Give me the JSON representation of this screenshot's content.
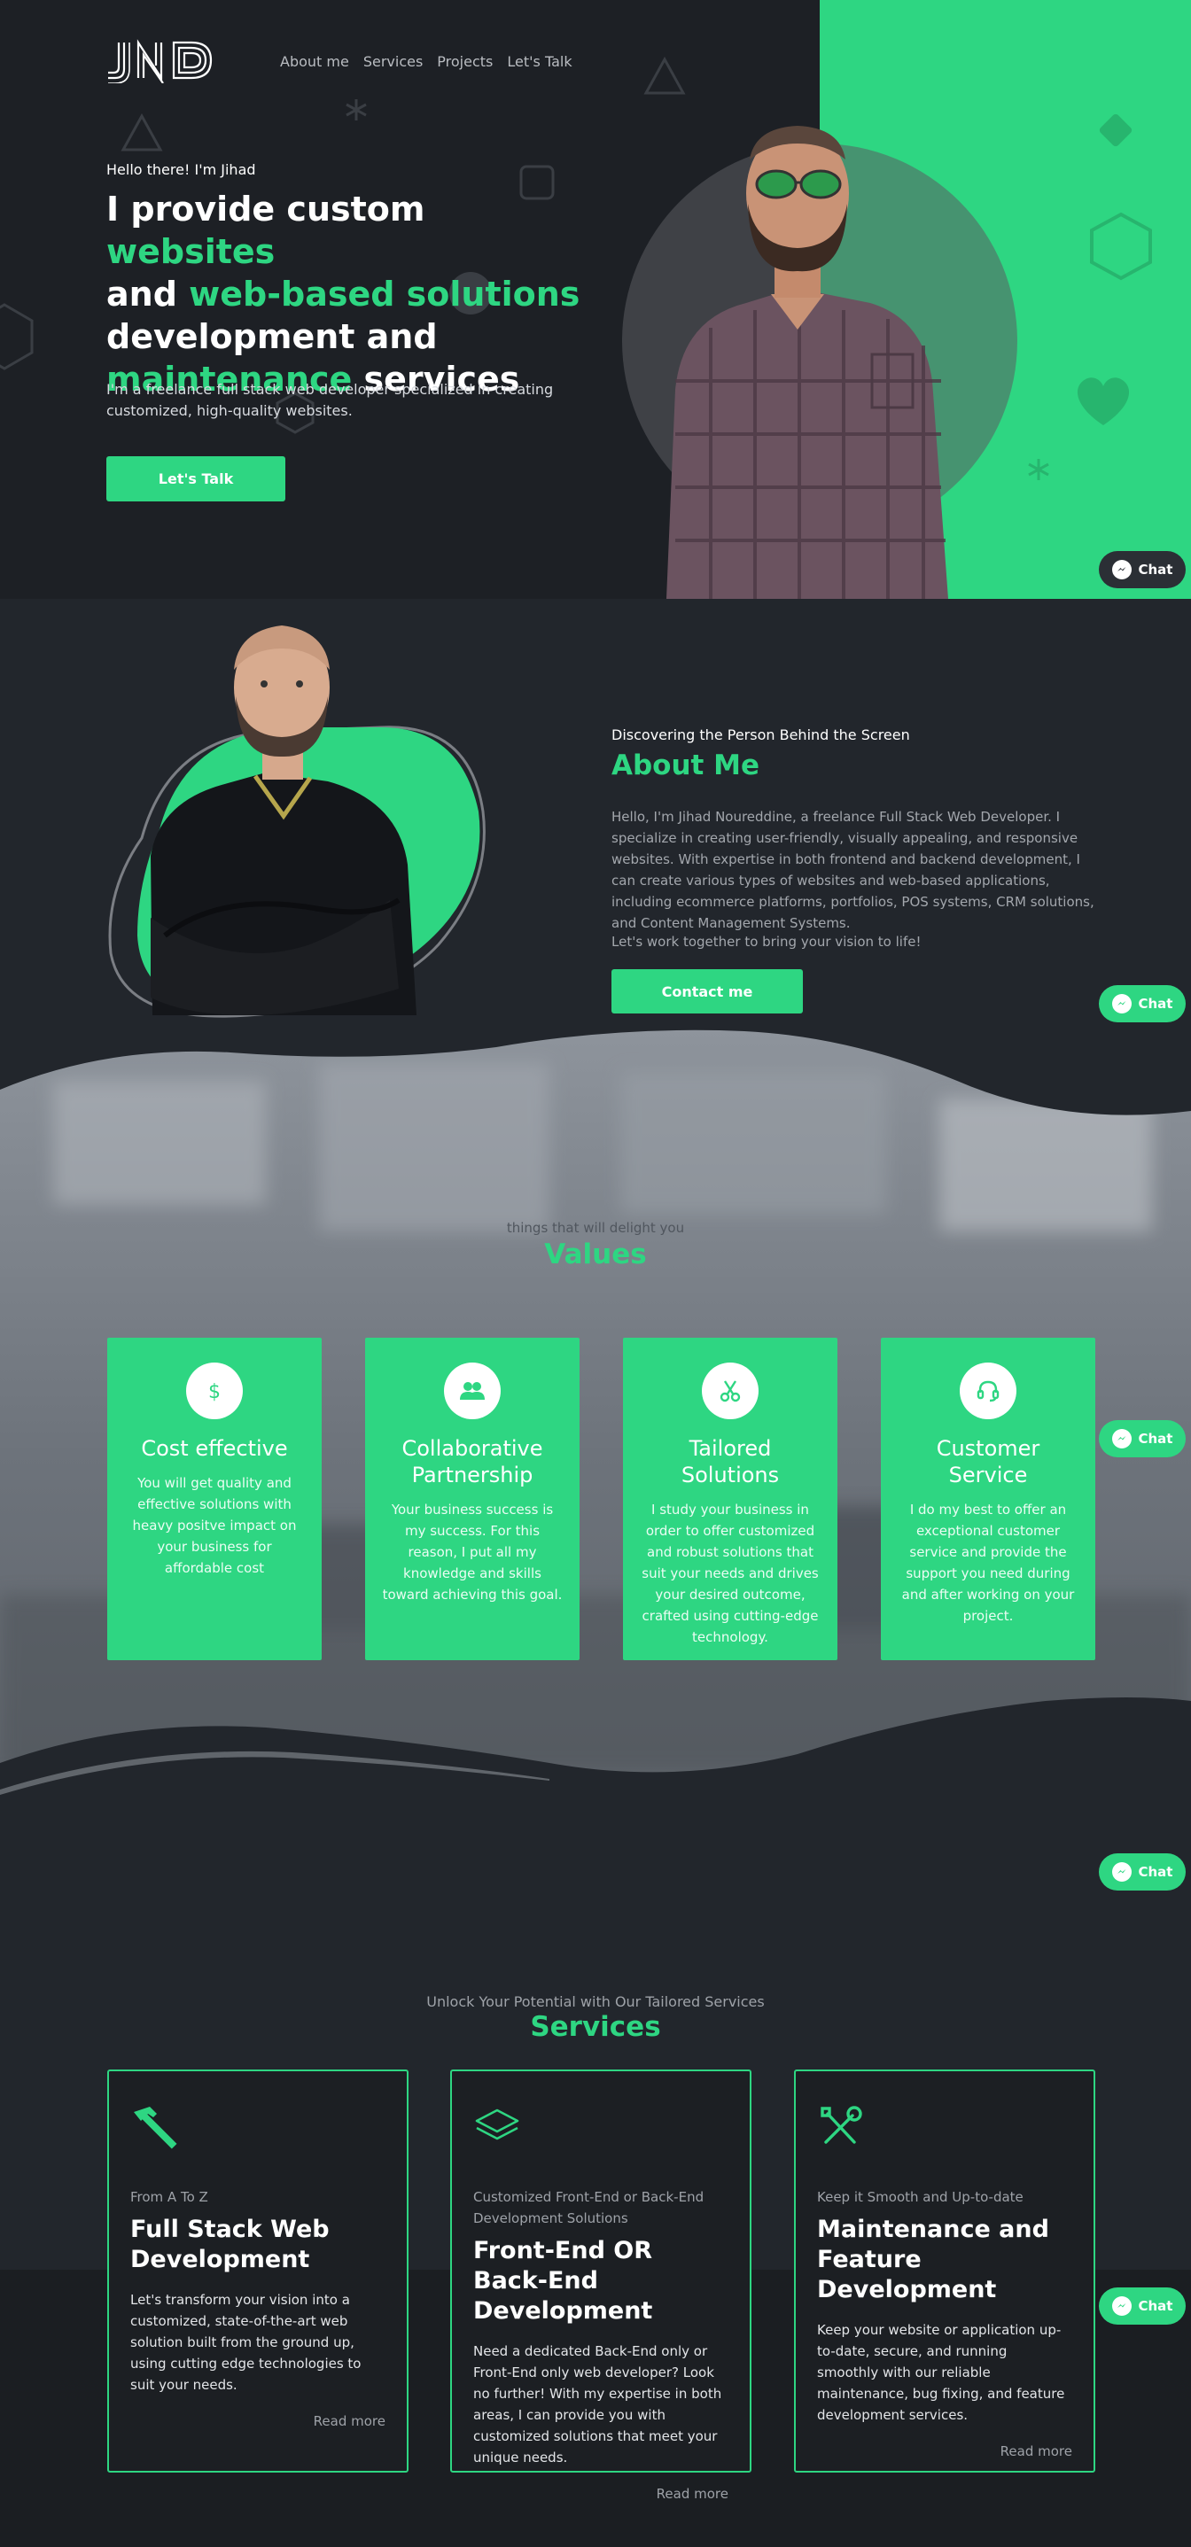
{
  "brand": {
    "logo_text": "JND",
    "accent": "#2ed682",
    "dark": "#1d2025"
  },
  "nav": {
    "items": [
      "About me",
      "Services",
      "Projects",
      "Let's Talk"
    ]
  },
  "hero": {
    "hello": "Hello there! I'm Jihad",
    "h_1": "I provide custom ",
    "h_2": "websites",
    "h_3": "and ",
    "h_4": "web-based solutions",
    "h_5": "development and",
    "h_6": "maintenance",
    "h_7": " services",
    "intro": "I'm a freelance full stack web developer specialized in creating customized, high-quality websites.",
    "button": "Let's Talk"
  },
  "chat": {
    "label": "Chat",
    "icon": "messenger-icon"
  },
  "about": {
    "subtitle": "Discovering the Person Behind the Screen",
    "title": "About Me",
    "paragraph": "Hello, I'm Jihad Noureddine, a freelance Full Stack Web Developer. I specialize in creating user-friendly, visually appealing, and responsive websites. With expertise in both frontend and backend development, I can create various types of websites and web-based applications, including ecommerce platforms, portfolios, POS systems, CRM solutions, and Content Management Systems.",
    "cta_text": "Let's work together to bring your vision to life!",
    "button": "Contact me"
  },
  "values": {
    "subtitle": "things that will delight you",
    "title": "Values",
    "cards": [
      {
        "icon": "dollar-icon",
        "title": "Cost effective",
        "text": "You will get quality and effective solutions with heavy positve impact on your business for affordable cost"
      },
      {
        "icon": "people-icon",
        "title": "Collaborative Partnership",
        "text": "Your business success is my success. For this reason, I put all my knowledge and skills toward achieving this goal."
      },
      {
        "icon": "scissors-icon",
        "title": "Tailored Solutions",
        "text": "I study your business in order to offer customized and robust solutions that suit your needs and drives your desired outcome, crafted using cutting-edge technology."
      },
      {
        "icon": "headset-icon",
        "title": "Customer Service",
        "text": "I do my best to offer an exceptional customer service and provide the support you need during and after working on your project."
      }
    ]
  },
  "services": {
    "subtitle": "Unlock Your Potential with Our Tailored Services",
    "title": "Services",
    "cards": [
      {
        "icon": "hammer-icon",
        "tag": "From A To Z",
        "title": "Full Stack Web Development",
        "text": "Let's transform your vision into a customized, state-of-the-art web solution built from the ground up, using cutting edge technologies to suit your needs.",
        "more": "Read more"
      },
      {
        "icon": "layers-icon",
        "tag": "Customized Front-End or Back-End Development Solutions",
        "title": "Front-End OR Back-End Development",
        "text": "Need a dedicated Back-End only or Front-End only web developer? Look no further! With my expertise in both areas, I can provide you with customized solutions that meet your unique needs.",
        "more": "Read more"
      },
      {
        "icon": "tools-icon",
        "tag": "Keep it Smooth and Up-to-date",
        "title": "Maintenance and Feature Development",
        "text": "Keep your website or application up-to-date, secure, and running smoothly with our reliable maintenance, bug fixing, and feature development services.",
        "more": "Read more"
      }
    ]
  }
}
